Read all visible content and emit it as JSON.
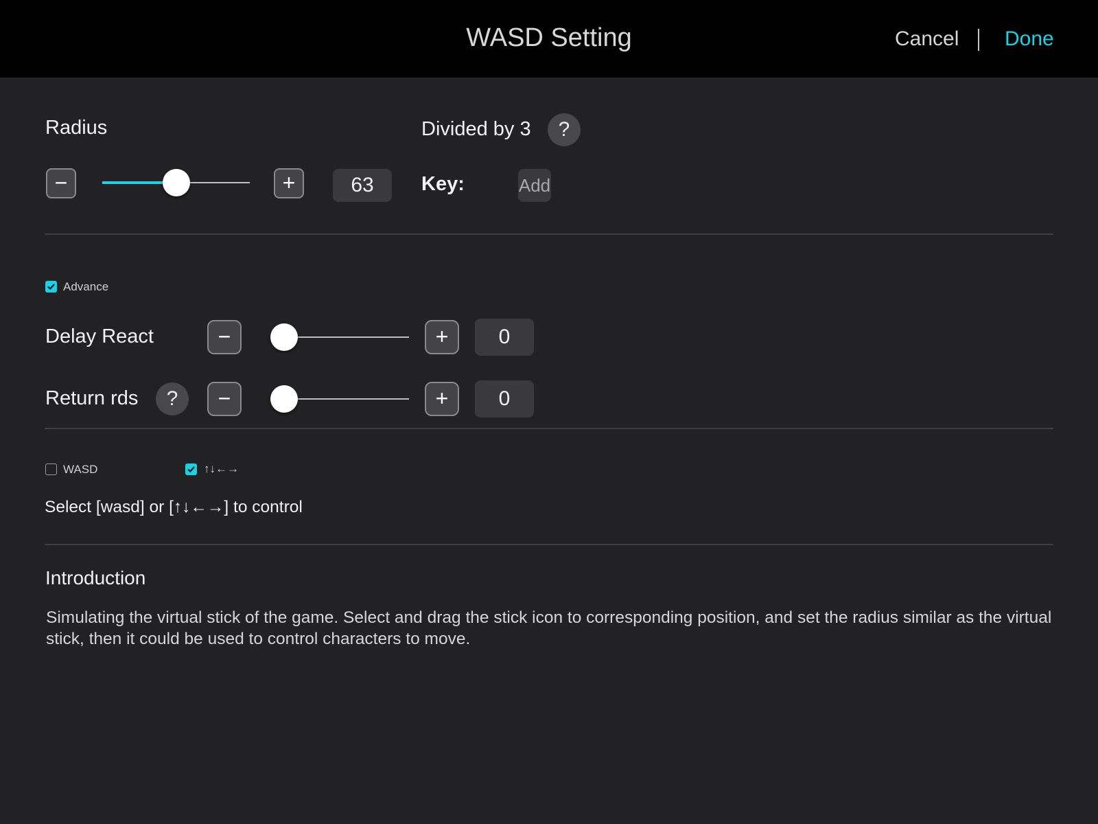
{
  "header": {
    "title": "WASD Setting",
    "cancel_label": "Cancel",
    "done_label": "Done",
    "accent_color": "#1ad2e6"
  },
  "radius": {
    "label": "Radius",
    "minus_icon": "minus-icon",
    "plus_icon": "plus-icon",
    "slider_fraction": 0.5,
    "value": "63"
  },
  "divided": {
    "label": "Divided by 3",
    "help_label": "?",
    "key_label": "Key:",
    "add_label": "Add"
  },
  "advance": {
    "label": "Advance",
    "checked": true,
    "delay_react": {
      "label": "Delay React",
      "slider_fraction": 0,
      "value": "0"
    },
    "return_rds": {
      "label": "Return rds",
      "help_label": "?",
      "slider_fraction": 0,
      "value": "0"
    }
  },
  "control": {
    "wasd_label": "WASD",
    "wasd_checked": false,
    "arrows_label": "↑↓←→",
    "arrows_checked": true,
    "hint": "Select [wasd] or [↑↓←→] to control"
  },
  "introduction": {
    "heading": "Introduction",
    "body": "Simulating the virtual stick of the game. Select and drag the stick icon to corresponding position, and set the radius similar as the virtual stick, then it could be used to control characters to move."
  }
}
